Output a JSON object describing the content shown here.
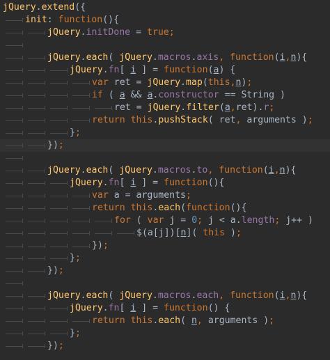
{
  "editor": {
    "theme": "darcula",
    "colors": {
      "background": "#2b2b2b",
      "text": "#a9b7c6",
      "keyword": "#cc7832",
      "function": "#ffc66d",
      "property": "#9876aa",
      "number": "#6897bb",
      "current_line": "#323232"
    },
    "lines": [
      {
        "indent": 0,
        "tokens": [
          {
            "t": "jQuery",
            "c": "f"
          },
          {
            "t": ".",
            "c": "p"
          },
          {
            "t": "extend",
            "c": "f"
          },
          {
            "t": "({",
            "c": "p"
          }
        ]
      },
      {
        "indent": 1,
        "tokens": [
          {
            "t": "init",
            "c": "f"
          },
          {
            "t": ": ",
            "c": "p"
          },
          {
            "t": "function",
            "c": "k"
          },
          {
            "t": "(){",
            "c": "p"
          }
        ]
      },
      {
        "indent": 2,
        "tokens": [
          {
            "t": "jQuery",
            "c": "f"
          },
          {
            "t": ".",
            "c": "p"
          },
          {
            "t": "initDone",
            "c": "m"
          },
          {
            "t": " = ",
            "c": "p"
          },
          {
            "t": "true",
            "c": "k"
          },
          {
            "t": ";",
            "c": "k"
          }
        ]
      },
      {
        "indent": 1,
        "tokens": []
      },
      {
        "indent": 2,
        "tokens": [
          {
            "t": "jQuery",
            "c": "f"
          },
          {
            "t": ".",
            "c": "p"
          },
          {
            "t": "each",
            "c": "f"
          },
          {
            "t": "( ",
            "c": "p"
          },
          {
            "t": "jQuery",
            "c": "f"
          },
          {
            "t": ".",
            "c": "p"
          },
          {
            "t": "macros",
            "c": "m"
          },
          {
            "t": ".",
            "c": "p"
          },
          {
            "t": "axis",
            "c": "m"
          },
          {
            "t": ", ",
            "c": "k"
          },
          {
            "t": "function",
            "c": "k"
          },
          {
            "t": "(",
            "c": "p"
          },
          {
            "t": "i",
            "c": "u"
          },
          {
            "t": ",",
            "c": "k"
          },
          {
            "t": "n",
            "c": "u"
          },
          {
            "t": "){",
            "c": "p"
          }
        ]
      },
      {
        "indent": 3,
        "tokens": [
          {
            "t": "jQuery",
            "c": "f"
          },
          {
            "t": ".",
            "c": "p"
          },
          {
            "t": "fn",
            "c": "m"
          },
          {
            "t": "[ ",
            "c": "p"
          },
          {
            "t": "i",
            "c": "u"
          },
          {
            "t": " ] = ",
            "c": "p"
          },
          {
            "t": "function",
            "c": "k"
          },
          {
            "t": "(",
            "c": "p"
          },
          {
            "t": "a",
            "c": "u"
          },
          {
            "t": ") {",
            "c": "p"
          }
        ]
      },
      {
        "indent": 4,
        "tokens": [
          {
            "t": "var",
            "c": "k"
          },
          {
            "t": " ret = ",
            "c": "p"
          },
          {
            "t": "jQuery",
            "c": "f"
          },
          {
            "t": ".",
            "c": "p"
          },
          {
            "t": "map",
            "c": "f"
          },
          {
            "t": "(",
            "c": "p"
          },
          {
            "t": "this",
            "c": "k"
          },
          {
            "t": ",",
            "c": "k"
          },
          {
            "t": "n",
            "c": "u"
          },
          {
            "t": ")",
            "c": "p"
          },
          {
            "t": ";",
            "c": "k"
          }
        ]
      },
      {
        "indent": 4,
        "tokens": [
          {
            "t": "if",
            "c": "k"
          },
          {
            "t": " ( ",
            "c": "p"
          },
          {
            "t": "a",
            "c": "u"
          },
          {
            "t": " && ",
            "c": "p"
          },
          {
            "t": "a",
            "c": "u"
          },
          {
            "t": ".",
            "c": "p"
          },
          {
            "t": "constructor",
            "c": "m"
          },
          {
            "t": " == String )",
            "c": "p"
          }
        ]
      },
      {
        "indent": 5,
        "tokens": [
          {
            "t": "ret = ",
            "c": "p"
          },
          {
            "t": "jQuery",
            "c": "f"
          },
          {
            "t": ".",
            "c": "p"
          },
          {
            "t": "filter",
            "c": "f"
          },
          {
            "t": "(",
            "c": "p"
          },
          {
            "t": "a",
            "c": "u"
          },
          {
            "t": ",",
            "c": "k"
          },
          {
            "t": "ret).",
            "c": "p"
          },
          {
            "t": "r",
            "c": "m"
          },
          {
            "t": ";",
            "c": "k"
          }
        ]
      },
      {
        "indent": 4,
        "tokens": [
          {
            "t": "return",
            "c": "k"
          },
          {
            "t": " ",
            "c": "p"
          },
          {
            "t": "this",
            "c": "k"
          },
          {
            "t": ".",
            "c": "p"
          },
          {
            "t": "pushStack",
            "c": "f"
          },
          {
            "t": "( ret",
            "c": "p"
          },
          {
            "t": ", ",
            "c": "k"
          },
          {
            "t": "arguments )",
            "c": "p"
          },
          {
            "t": ";",
            "c": "k"
          }
        ]
      },
      {
        "indent": 3,
        "tokens": [
          {
            "t": "}",
            "c": "p"
          },
          {
            "t": ";",
            "c": "k"
          }
        ]
      },
      {
        "indent": 2,
        "tokens": [
          {
            "t": "})",
            "c": "p"
          },
          {
            "t": ";",
            "c": "k"
          }
        ],
        "current": true
      },
      {
        "indent": 1,
        "tokens": []
      },
      {
        "indent": 2,
        "tokens": [
          {
            "t": "jQuery",
            "c": "f"
          },
          {
            "t": ".",
            "c": "p"
          },
          {
            "t": "each",
            "c": "f"
          },
          {
            "t": "( ",
            "c": "p"
          },
          {
            "t": "jQuery",
            "c": "f"
          },
          {
            "t": ".",
            "c": "p"
          },
          {
            "t": "macros",
            "c": "m"
          },
          {
            "t": ".",
            "c": "p"
          },
          {
            "t": "to",
            "c": "m"
          },
          {
            "t": ", ",
            "c": "k"
          },
          {
            "t": "function",
            "c": "k"
          },
          {
            "t": "(",
            "c": "p"
          },
          {
            "t": "i",
            "c": "u"
          },
          {
            "t": ",",
            "c": "k"
          },
          {
            "t": "n",
            "c": "u"
          },
          {
            "t": "){",
            "c": "p"
          }
        ]
      },
      {
        "indent": 3,
        "tokens": [
          {
            "t": "jQuery",
            "c": "f"
          },
          {
            "t": ".",
            "c": "p"
          },
          {
            "t": "fn",
            "c": "m"
          },
          {
            "t": "[ ",
            "c": "p"
          },
          {
            "t": "i",
            "c": "u"
          },
          {
            "t": " ] = ",
            "c": "p"
          },
          {
            "t": "function",
            "c": "k"
          },
          {
            "t": "(){",
            "c": "p"
          }
        ]
      },
      {
        "indent": 4,
        "tokens": [
          {
            "t": "var",
            "c": "k"
          },
          {
            "t": " a = arguments",
            "c": "p"
          },
          {
            "t": ";",
            "c": "k"
          }
        ]
      },
      {
        "indent": 4,
        "tokens": [
          {
            "t": "return",
            "c": "k"
          },
          {
            "t": " ",
            "c": "p"
          },
          {
            "t": "this",
            "c": "k"
          },
          {
            "t": ".",
            "c": "p"
          },
          {
            "t": "each",
            "c": "f"
          },
          {
            "t": "(",
            "c": "p"
          },
          {
            "t": "function",
            "c": "k"
          },
          {
            "t": "(){",
            "c": "p"
          }
        ]
      },
      {
        "indent": 5,
        "tokens": [
          {
            "t": "for",
            "c": "k"
          },
          {
            "t": " ( ",
            "c": "p"
          },
          {
            "t": "var",
            "c": "k"
          },
          {
            "t": " j = ",
            "c": "p"
          },
          {
            "t": "0",
            "c": "n"
          },
          {
            "t": "; ",
            "c": "k"
          },
          {
            "t": "j < a.",
            "c": "p"
          },
          {
            "t": "length",
            "c": "m"
          },
          {
            "t": "; ",
            "c": "k"
          },
          {
            "t": "j++ )",
            "c": "p"
          }
        ]
      },
      {
        "indent": 6,
        "tokens": [
          {
            "t": "$(a[j])[",
            "c": "p"
          },
          {
            "t": "n",
            "c": "u"
          },
          {
            "t": "]( ",
            "c": "p"
          },
          {
            "t": "this",
            "c": "k"
          },
          {
            "t": " )",
            "c": "p"
          },
          {
            "t": ";",
            "c": "k"
          }
        ]
      },
      {
        "indent": 4,
        "tokens": [
          {
            "t": "})",
            "c": "p"
          },
          {
            "t": ";",
            "c": "k"
          }
        ]
      },
      {
        "indent": 3,
        "tokens": [
          {
            "t": "}",
            "c": "p"
          },
          {
            "t": ";",
            "c": "k"
          }
        ]
      },
      {
        "indent": 2,
        "tokens": [
          {
            "t": "})",
            "c": "p"
          },
          {
            "t": ";",
            "c": "k"
          }
        ]
      },
      {
        "indent": 1,
        "tokens": []
      },
      {
        "indent": 2,
        "tokens": [
          {
            "t": "jQuery",
            "c": "f"
          },
          {
            "t": ".",
            "c": "p"
          },
          {
            "t": "each",
            "c": "f"
          },
          {
            "t": "( ",
            "c": "p"
          },
          {
            "t": "jQuery",
            "c": "f"
          },
          {
            "t": ".",
            "c": "p"
          },
          {
            "t": "macros",
            "c": "m"
          },
          {
            "t": ".",
            "c": "p"
          },
          {
            "t": "each",
            "c": "m"
          },
          {
            "t": ", ",
            "c": "k"
          },
          {
            "t": "function",
            "c": "k"
          },
          {
            "t": "(",
            "c": "p"
          },
          {
            "t": "i",
            "c": "u"
          },
          {
            "t": ",",
            "c": "k"
          },
          {
            "t": "n",
            "c": "u"
          },
          {
            "t": "){",
            "c": "p"
          }
        ]
      },
      {
        "indent": 3,
        "tokens": [
          {
            "t": "jQuery",
            "c": "f"
          },
          {
            "t": ".",
            "c": "p"
          },
          {
            "t": "fn",
            "c": "m"
          },
          {
            "t": "[ ",
            "c": "p"
          },
          {
            "t": "i",
            "c": "u"
          },
          {
            "t": " ] = ",
            "c": "p"
          },
          {
            "t": "function",
            "c": "k"
          },
          {
            "t": "() {",
            "c": "p"
          }
        ]
      },
      {
        "indent": 4,
        "tokens": [
          {
            "t": "return",
            "c": "k"
          },
          {
            "t": " ",
            "c": "p"
          },
          {
            "t": "this",
            "c": "k"
          },
          {
            "t": ".",
            "c": "p"
          },
          {
            "t": "each",
            "c": "f"
          },
          {
            "t": "( ",
            "c": "p"
          },
          {
            "t": "n",
            "c": "u"
          },
          {
            "t": ", ",
            "c": "k"
          },
          {
            "t": "arguments )",
            "c": "p"
          },
          {
            "t": ";",
            "c": "k"
          }
        ]
      },
      {
        "indent": 3,
        "tokens": [
          {
            "t": "}",
            "c": "p"
          },
          {
            "t": ";",
            "c": "k"
          }
        ]
      },
      {
        "indent": 2,
        "tokens": [
          {
            "t": "})",
            "c": "p"
          },
          {
            "t": ";",
            "c": "k"
          }
        ]
      }
    ]
  }
}
